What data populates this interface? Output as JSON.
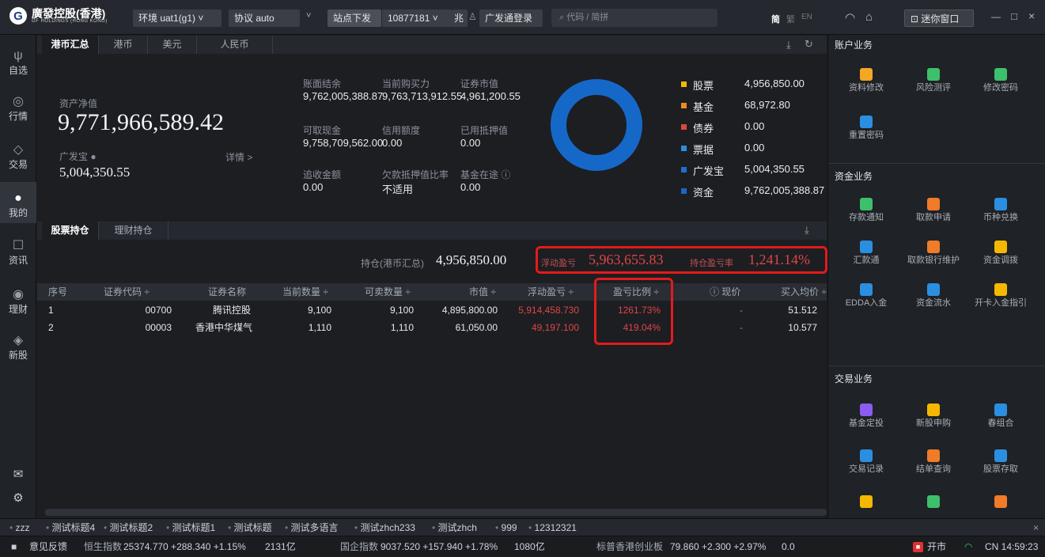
{
  "topbar": {
    "logo_glyph": "G",
    "logo_name": "廣發控股(香港)",
    "logo_sub": "GF HOLDINGS (HONG KONG)",
    "env": "环境 uat1(g1) ˅",
    "protocol": "协议 auto",
    "protocol_caret": "˅",
    "station": "站点下发",
    "account": "10877181 ˅",
    "login_tag": "兆",
    "login": "广发通登录",
    "search_placeholder": "代码 / 简拼",
    "lang_jian": "简",
    "lang_fan": "繁",
    "lang_en": "EN",
    "mini": "迷你窗口",
    "win_min": "—",
    "win_max": "□",
    "win_close": "×"
  },
  "leftnav": [
    {
      "icon": "market-icon",
      "glyph": "ψ",
      "label": "自选"
    },
    {
      "icon": "quote-icon",
      "glyph": "◎",
      "label": "行情"
    },
    {
      "icon": "trade-icon",
      "glyph": "◇",
      "label": "交易"
    },
    {
      "icon": "user-icon",
      "glyph": "●",
      "label": "我的"
    },
    {
      "icon": "news-icon",
      "glyph": "☐",
      "label": "资讯"
    },
    {
      "icon": "wealth-icon",
      "glyph": "◉",
      "label": "理财"
    },
    {
      "icon": "ipo-icon",
      "glyph": "◈",
      "label": "新股"
    }
  ],
  "leftnav_bottom": {
    "mail_icon": "mail-icon",
    "settings_icon": "settings-icon",
    "mail": "✉",
    "settings": "⚙"
  },
  "currency_tabs": [
    "港币汇总",
    "港币",
    "美元",
    "人民币"
  ],
  "summary": {
    "net_asset_label": "资产净值",
    "net_asset": "9,771,966,589.42",
    "gfb_label": "广发宝",
    "gfb_value": "5,004,350.55",
    "detail": "详情 >",
    "fields": [
      {
        "label": "账面结余",
        "value": "9,762,005,388.87"
      },
      {
        "label": "当前购买力",
        "value": "9,763,713,912.55"
      },
      {
        "label": "证券市值",
        "value": "4,961,200.55"
      },
      {
        "label": "可取现金",
        "value": "9,758,709,562.00"
      },
      {
        "label": "信用额度",
        "value": "0.00"
      },
      {
        "label": "已用抵押值",
        "value": "0.00"
      },
      {
        "label": "追收金额",
        "value": "0.00"
      },
      {
        "label": "欠款抵押值比率",
        "value": "不适用"
      },
      {
        "label": "基金在途",
        "value": "0.00"
      }
    ],
    "legend": [
      {
        "label": "股票",
        "value": "4,956,850.00",
        "color": "#f5b800"
      },
      {
        "label": "基金",
        "value": "68,972.80",
        "color": "#f08a24"
      },
      {
        "label": "债券",
        "value": "0.00",
        "color": "#e0473c"
      },
      {
        "label": "票据",
        "value": "0.00",
        "color": "#2a8fe0"
      },
      {
        "label": "广发宝",
        "value": "5,004,350.55",
        "color": "#1f6fd1"
      },
      {
        "label": "资金",
        "value": "9,762,005,388.87",
        "color": "#1668c8"
      }
    ]
  },
  "holdings_tabs": [
    "股票持仓",
    "理财持仓"
  ],
  "holdings_summary": {
    "pos_label": "持仓(港币汇总)",
    "pos_value": "4,956,850.00",
    "float_label": "浮动盈亏",
    "float_value": "5,963,655.83",
    "rate_label": "持仓盈亏率",
    "rate_value": "1,241.14%"
  },
  "table": {
    "headers": [
      "序号",
      "证券代码 ÷",
      "证券名称",
      "当前数量 ÷",
      "可卖数量 ÷",
      "市值 ÷",
      "浮动盈亏 ÷",
      "盈亏比例 ÷",
      "现价",
      "买入均价 ÷"
    ],
    "rows": [
      [
        "1",
        "00700",
        "腾讯控股",
        "9,100",
        "9,100",
        "4,895,800.00",
        "5,914,458.730",
        "1261.73%",
        "-",
        "51.512"
      ],
      [
        "2",
        "00003",
        "香港中华煤气",
        "1,110",
        "1,110",
        "61,050.00",
        "49,197.100",
        "419.04%",
        "-",
        "10.577"
      ]
    ]
  },
  "right_panel": {
    "sections": [
      {
        "title": "账户业务",
        "items": [
          {
            "label": "资料修改",
            "color": "#f5a623"
          },
          {
            "label": "风险测评",
            "color": "#3cc06b"
          },
          {
            "label": "修改密码",
            "color": "#3cc06b"
          },
          {
            "label": "重置密码",
            "color": "#2a8fe0"
          }
        ]
      },
      {
        "title": "资金业务",
        "items": [
          {
            "label": "存款通知",
            "color": "#3cc06b"
          },
          {
            "label": "取款申请",
            "color": "#f07b28"
          },
          {
            "label": "币种兑换",
            "color": "#2a8fe0"
          },
          {
            "label": "汇款通",
            "color": "#2a8fe0"
          },
          {
            "label": "取款银行维护",
            "color": "#f07b28"
          },
          {
            "label": "资金调拨",
            "color": "#f5b800"
          },
          {
            "label": "EDDA入金",
            "color": "#2a8fe0"
          },
          {
            "label": "资金流水",
            "color": "#2a8fe0"
          },
          {
            "label": "开卡入金指引",
            "color": "#f5b800"
          }
        ]
      },
      {
        "title": "交易业务",
        "items": [
          {
            "label": "基金定投",
            "color": "#8a5cf0"
          },
          {
            "label": "新股申购",
            "color": "#f5b800"
          },
          {
            "label": "春组合",
            "color": "#2a8fe0"
          },
          {
            "label": "交易记录",
            "color": "#2a8fe0"
          },
          {
            "label": "结单查询",
            "color": "#f07b28"
          },
          {
            "label": "股票存取",
            "color": "#2a8fe0"
          },
          {
            "label": "",
            "color": "#f5b800"
          },
          {
            "label": "",
            "color": "#3cc06b"
          },
          {
            "label": "",
            "color": "#f07b28"
          }
        ]
      }
    ]
  },
  "ticker": [
    "zzz",
    "测试标题4",
    "测试标题2",
    "测试标题1",
    "测试标题",
    "测试多语言",
    "测试zhch233",
    "测试zhch",
    "999",
    "12312321"
  ],
  "ticker_close": "×",
  "status": {
    "feedback": "意见反馈",
    "hsi_name": "恒生指数",
    "hsi_value": "25374.770 +288.340 +1.15%",
    "hsi_vol": "2131亿",
    "hscei_name": "国企指数",
    "hscei_value": "9037.520 +157.940 +1.78%",
    "hscei_vol": "1080亿",
    "gem_name": "标普香港创业板",
    "gem_value": "79.860 +2.300 +2.97%",
    "gem_vol": "0.0",
    "market": "开市",
    "clock": "CN 14:59:23"
  },
  "colors": {
    "accent_red": "#e31b1b",
    "donut": "#1668c8",
    "up": "#e04545"
  }
}
